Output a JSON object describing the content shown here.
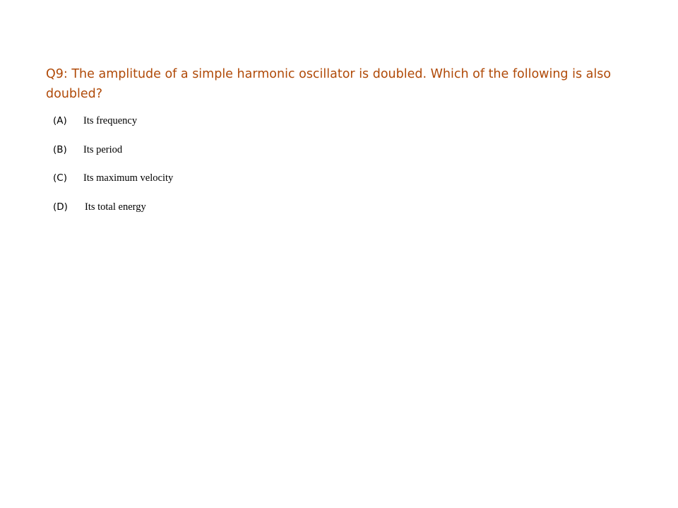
{
  "question": {
    "text": "Q9: The amplitude of a simple harmonic oscillator is doubled. Which of the following is also doubled?",
    "color": "#b04a08"
  },
  "options": [
    {
      "letter": "(A)",
      "text": "Its frequency"
    },
    {
      "letter": "(B)",
      "text": "Its period"
    },
    {
      "letter": "(C)",
      "text": "Its maximum velocity"
    },
    {
      "letter": "(D)",
      "text": "Its total energy"
    }
  ]
}
